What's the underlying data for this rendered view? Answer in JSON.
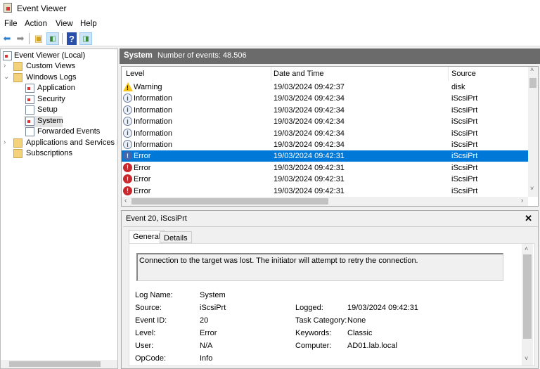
{
  "window": {
    "title": "Event Viewer"
  },
  "menu": [
    "File",
    "Action",
    "View",
    "Help"
  ],
  "tree": {
    "root": "Event Viewer (Local)",
    "items": [
      {
        "label": "Custom Views"
      },
      {
        "label": "Windows Logs"
      },
      {
        "label": "Application"
      },
      {
        "label": "Security"
      },
      {
        "label": "Setup"
      },
      {
        "label": "System"
      },
      {
        "label": "Forwarded Events"
      },
      {
        "label": "Applications and Services Lo"
      },
      {
        "label": "Subscriptions"
      }
    ]
  },
  "list": {
    "header_title": "System",
    "header_count": "Number of events: 48.506",
    "columns": [
      "Level",
      "Date and Time",
      "Source"
    ],
    "rows": [
      {
        "level": "Warning",
        "icon": "warning",
        "date": "19/03/2024 09:42:37",
        "source": "disk"
      },
      {
        "level": "Information",
        "icon": "info",
        "date": "19/03/2024 09:42:34",
        "source": "iScsiPrt"
      },
      {
        "level": "Information",
        "icon": "info",
        "date": "19/03/2024 09:42:34",
        "source": "iScsiPrt"
      },
      {
        "level": "Information",
        "icon": "info",
        "date": "19/03/2024 09:42:34",
        "source": "iScsiPrt"
      },
      {
        "level": "Information",
        "icon": "info",
        "date": "19/03/2024 09:42:34",
        "source": "iScsiPrt"
      },
      {
        "level": "Information",
        "icon": "info",
        "date": "19/03/2024 09:42:34",
        "source": "iScsiPrt"
      },
      {
        "level": "Error",
        "icon": "error",
        "date": "19/03/2024 09:42:31",
        "source": "iScsiPrt",
        "selected": true
      },
      {
        "level": "Error",
        "icon": "error",
        "date": "19/03/2024 09:42:31",
        "source": "iScsiPrt"
      },
      {
        "level": "Error",
        "icon": "error",
        "date": "19/03/2024 09:42:31",
        "source": "iScsiPrt"
      },
      {
        "level": "Error",
        "icon": "error",
        "date": "19/03/2024 09:42:31",
        "source": "iScsiPrt"
      }
    ]
  },
  "detail": {
    "title": "Event 20, iScsiPrt",
    "close": "✕",
    "tabs": [
      "General",
      "Details"
    ],
    "message": "Connection to the target was lost. The initiator will attempt to retry the connection.",
    "fields_left": [
      {
        "label": "Log Name:",
        "value": "System"
      },
      {
        "label": "Source:",
        "value": "iScsiPrt"
      },
      {
        "label": "Event ID:",
        "value": "20"
      },
      {
        "label": "Level:",
        "value": "Error"
      },
      {
        "label": "User:",
        "value": "N/A"
      },
      {
        "label": "OpCode:",
        "value": "Info"
      }
    ],
    "fields_right": [
      {
        "label": "Logged:",
        "value": "19/03/2024 09:42:31"
      },
      {
        "label": "Task Category:",
        "value": "None"
      },
      {
        "label": "Keywords:",
        "value": "Classic"
      },
      {
        "label": "Computer:",
        "value": "AD01.lab.local"
      }
    ]
  }
}
